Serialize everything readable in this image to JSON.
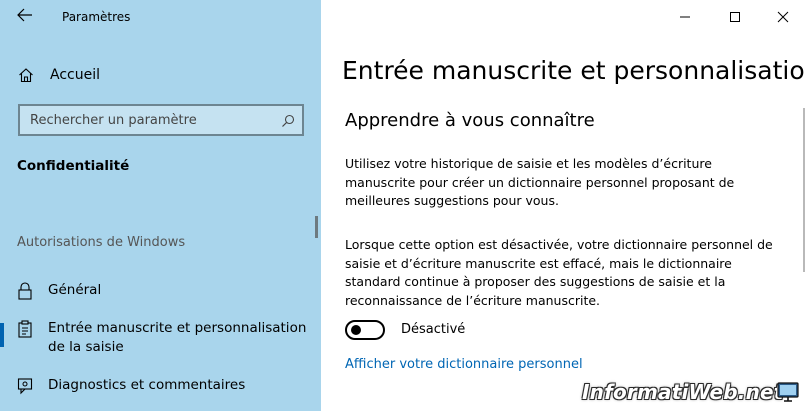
{
  "window": {
    "app_title": "Paramètres",
    "controls": {
      "minimize": "minimize-icon",
      "maximize": "maximize-icon",
      "close": "close-icon"
    }
  },
  "sidebar": {
    "home_label": "Accueil",
    "search_placeholder": "Rechercher un paramètre",
    "section_title": "Confidentialité",
    "group_title": "Autorisations de Windows",
    "items": [
      {
        "label": "Général",
        "icon": "lock-icon"
      },
      {
        "label": "Entrée manuscrite et personnalisation de la saisie",
        "icon": "clipboard-icon",
        "selected": true
      },
      {
        "label": "Diagnostics et commentaires",
        "icon": "feedback-icon"
      }
    ]
  },
  "main": {
    "page_title": "Entrée manuscrite et personnalisation de la saisie",
    "section_title": "Apprendre à vous connaître",
    "description": "Utilisez votre historique de saisie et les modèles d’écriture manuscrite pour créer un dictionnaire personnel proposant de meilleures suggestions pour vous.",
    "note": "Lorsque cette option est désactivée, votre dictionnaire personnel de saisie et d’écriture manuscrite est effacé, mais le dictionnaire standard continue à proposer des suggestions de saisie et la reconnaissance de l’écriture manuscrite.",
    "toggle_state_label": "Désactivé",
    "toggle_on": false,
    "link_label": "Afficher votre dictionnaire personnel"
  },
  "watermark": {
    "text": "InformatiWeb.net"
  },
  "colors": {
    "sidebar_bg": "#a9d5ec",
    "accent": "#0063b1",
    "link": "#0066b4"
  }
}
